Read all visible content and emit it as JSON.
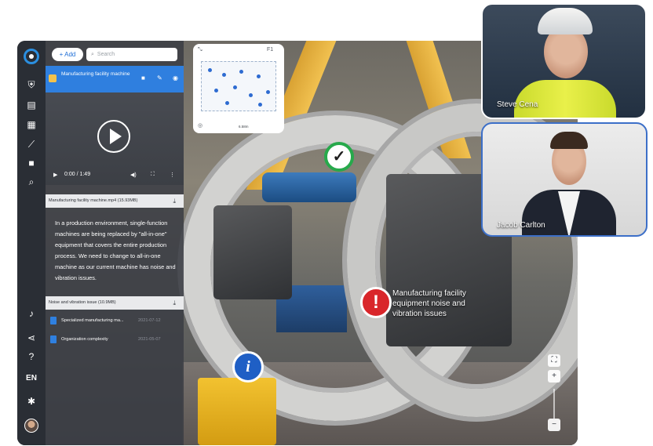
{
  "toolbar": {
    "add_label": "+ Add",
    "search_placeholder": "Search"
  },
  "selected_item": {
    "title": "Manufacturing facility machine"
  },
  "video": {
    "time": "0:00 / 1:49"
  },
  "attachments": [
    {
      "name": "Manufacturing facility machine.mp4 (15.93MB)"
    },
    {
      "name": "Noise and vibration issue (10.9MB)"
    }
  ],
  "description": "In a production environment, single-function machines are being replaced by \"all-in-one\" equipment that covers the entire production process. We need to change to all-in-one machine as our current machine has noise and vibration issues.",
  "documents": [
    {
      "name": "Specialized manufacturing ma...",
      "date": "2021-07-12"
    },
    {
      "name": "Organization complexity",
      "date": "2021-05-07"
    }
  ],
  "floorplan": {
    "floor": "F1",
    "scale": "6.58m"
  },
  "markers": {
    "alert_label": "Manufacturing facility equipment noise and vibration issues"
  },
  "rail": {
    "language": "EN"
  },
  "participants": [
    {
      "name": "Steve Cena"
    },
    {
      "name": "Jacob Carlton"
    }
  ],
  "colors": {
    "accent": "#2f7fdf",
    "alert": "#d9262a",
    "success": "#27a94b",
    "info": "#1f5fc5"
  }
}
